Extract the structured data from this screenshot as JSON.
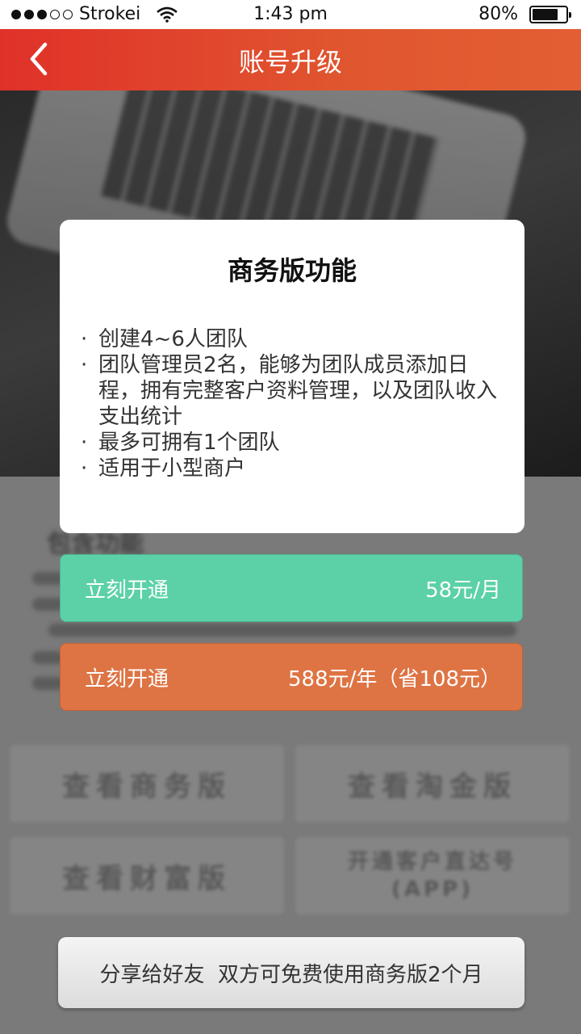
{
  "status_bar": {
    "carrier": "Strokei",
    "time": "1:43 pm",
    "battery_percent": "80%",
    "battery_level": 0.8,
    "signal_filled": 3,
    "signal_total": 5
  },
  "nav": {
    "title": "账号升级",
    "back_icon": "chevron-left-icon"
  },
  "background": {
    "section_heading": "包含功能",
    "tiles": [
      "查看商务版",
      "查看淘金版",
      "查看财富版",
      "开通客户直达号\n(APP)"
    ]
  },
  "modal": {
    "title": "商务版功能",
    "bullet": "·",
    "features": [
      "创建4~6人团队",
      "团队管理员2名，能够为团队成员添加日程，拥有完整客户资料管理，以及团队收入支出统计",
      "最多可拥有1个团队",
      "适用于小型商户"
    ]
  },
  "plans": {
    "monthly": {
      "action": "立刻开通",
      "price": "58元/月"
    },
    "yearly": {
      "action": "立刻开通",
      "price": "588元/年（省108元）"
    }
  },
  "share": {
    "label": "分享给好友  双方可免费使用商务版2个月"
  },
  "colors": {
    "nav_start": "#e03129",
    "nav_end": "#e35f33",
    "monthly_plan": "#5cd1a8",
    "yearly_plan": "#de7444"
  }
}
